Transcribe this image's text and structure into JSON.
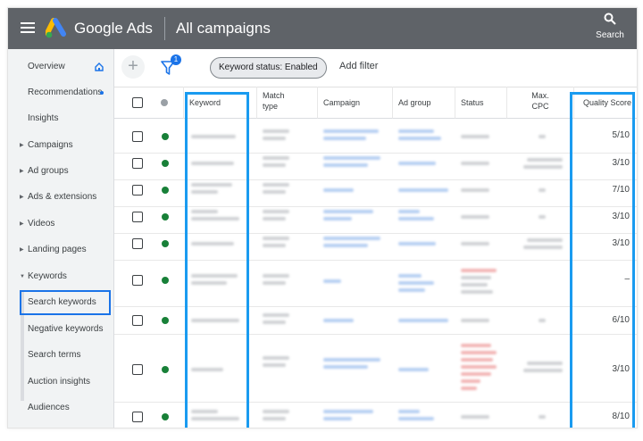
{
  "header": {
    "brand": "Google Ads",
    "page_title": "All campaigns",
    "search_label": "Search"
  },
  "sidebar": {
    "items": [
      {
        "label": "Overview"
      },
      {
        "label": "Recommendations"
      },
      {
        "label": "Insights"
      },
      {
        "label": "Campaigns"
      },
      {
        "label": "Ad groups"
      },
      {
        "label": "Ads & extensions"
      },
      {
        "label": "Videos"
      },
      {
        "label": "Landing pages"
      },
      {
        "label": "Keywords"
      },
      {
        "label": "Search keywords"
      },
      {
        "label": "Negative keywords"
      },
      {
        "label": "Search terms"
      },
      {
        "label": "Auction insights"
      },
      {
        "label": "Audiences"
      }
    ]
  },
  "toolbar": {
    "filter_count": "1",
    "chip_label": "Keyword status: Enabled",
    "add_filter_label": "Add filter"
  },
  "table": {
    "headers": {
      "keyword": "Keyword",
      "match_type": "Match\ntype",
      "campaign": "Campaign",
      "ad_group": "Ad group",
      "status": "Status",
      "max_cpc": "Max.\nCPC",
      "quality_score": "Quality Score"
    },
    "quality_scores": [
      "5/10",
      "3/10",
      "7/10",
      "3/10",
      "3/10",
      "–",
      "6/10",
      "3/10",
      "8/10"
    ]
  },
  "colors": {
    "accent": "#1a73e8",
    "highlight": "#1a9bf0",
    "enabled_dot": "#188038",
    "header_bar": "#5f6368"
  }
}
